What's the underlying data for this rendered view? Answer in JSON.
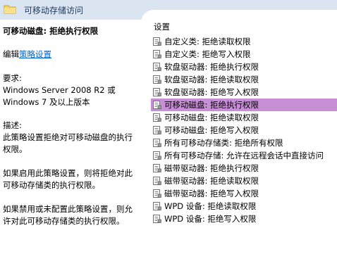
{
  "header": {
    "title": "可移动存储访问"
  },
  "left": {
    "policy_title": "可移动磁盘: 拒绝执行权限",
    "edit_prefix": "编辑",
    "edit_link": "策略设置",
    "requirements_label": "要求:",
    "requirements_text": "Windows Server 2008 R2 或\nWindows 7 及以上版本",
    "description_label": "描述:",
    "description_text": "此策略设置拒绝对可移动磁盘的执行\n权限。",
    "enabled_text": "如果启用此策略设置，则将拒绝对此\n可移动存储类的执行权限。",
    "disabled_text": "如果禁用或未配置此策略设置，则允\n许对此可移动存储类的执行权限。"
  },
  "right": {
    "header": "设置",
    "items": [
      {
        "label": "自定义类: 拒绝读取权限"
      },
      {
        "label": "自定义类: 拒绝写入权限"
      },
      {
        "label": "软盘驱动器: 拒绝执行权限"
      },
      {
        "label": "软盘驱动器: 拒绝读取权限"
      },
      {
        "label": "软盘驱动器: 拒绝写入权限"
      },
      {
        "label": "可移动磁盘: 拒绝执行权限",
        "selected": true
      },
      {
        "label": "可移动磁盘: 拒绝读取权限"
      },
      {
        "label": "可移动磁盘: 拒绝写入权限"
      },
      {
        "label": "所有可移动存储类: 拒绝所有权限"
      },
      {
        "label": "所有可移动存储: 允许在远程会话中直接访问"
      },
      {
        "label": "磁带驱动器: 拒绝执行权限"
      },
      {
        "label": "磁带驱动器: 拒绝读取权限"
      },
      {
        "label": "磁带驱动器: 拒绝写入权限"
      },
      {
        "label": "WPD 设备: 拒绝读取权限"
      },
      {
        "label": "WPD 设备: 拒绝写入权限"
      }
    ]
  },
  "icons": {
    "header": "folder-icon",
    "item": "policy-setting-icon"
  },
  "colors": {
    "header_bg": "#dbe5f1",
    "selected_bg": "#c98fd6",
    "link": "#0066cc"
  }
}
